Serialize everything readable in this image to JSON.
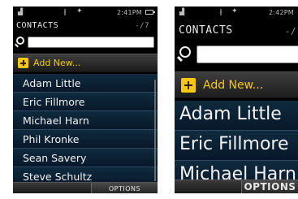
{
  "screens": {
    "small": {
      "status": {
        "time": "2:41PM"
      },
      "title": "CONTACTS",
      "count": "-/7",
      "search": {
        "value": "",
        "placeholder": ""
      },
      "add_new": "Add New...",
      "contacts": [
        "Adam Little",
        "Eric Fillmore",
        "Michael Harn",
        "Phil Kronke",
        "Sean Savery",
        "Steve Schultz"
      ],
      "softkey": "OPTIONS"
    },
    "large": {
      "status": {
        "time": "2:42PM"
      },
      "title": "CONTACTS",
      "count": "-/",
      "search": {
        "value": "",
        "placeholder": ""
      },
      "add_new": "Add New...",
      "contacts": [
        "Adam Little",
        "Eric Fillmore",
        "Michael Harn"
      ],
      "softkey": "OPTIONS"
    }
  },
  "icons": {
    "signal": "signal-icon",
    "bluetooth": "bluetooth-icon",
    "gps": "gps-icon",
    "battery": "battery-icon",
    "search": "search-icon",
    "add": "plus-icon"
  },
  "colors": {
    "accent": "#f7c711",
    "list_bg": "#0f2a3e",
    "screen_bg": "#000000"
  }
}
